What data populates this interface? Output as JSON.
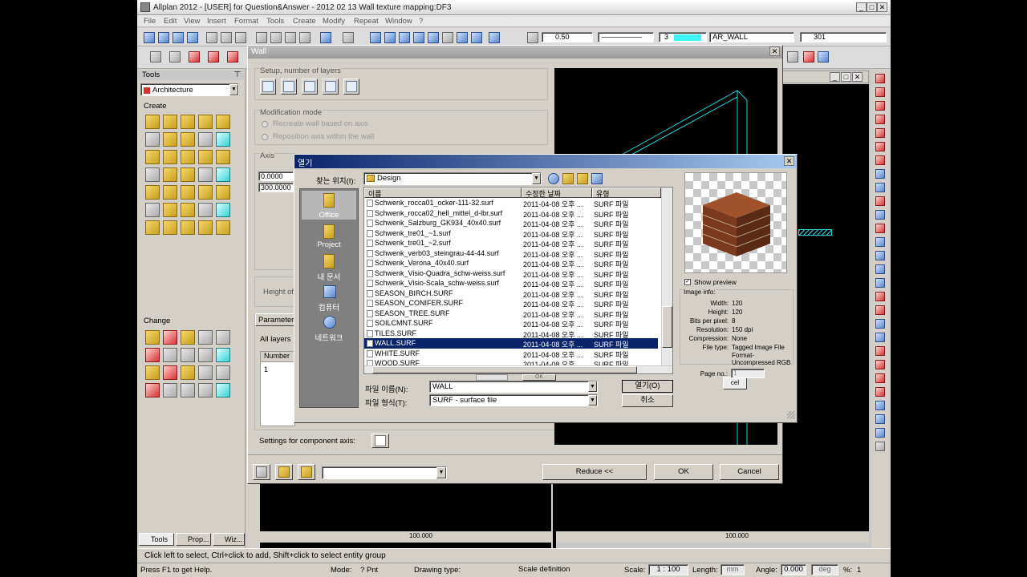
{
  "app": {
    "title": "Allplan 2012 - [USER] for Question&Answer - 2012 02 13 Wall texture mapping:DF3",
    "menu": [
      "File",
      "Edit",
      "View",
      "Insert",
      "Format",
      "Tools",
      "Create",
      "Modify",
      "Repeat",
      "Window",
      "?"
    ],
    "pen_value": "0.50",
    "color_value": "3",
    "layer_value": "AR_WALL",
    "pattern_value": "301"
  },
  "tools_panel": {
    "title": "Tools",
    "module": "Architecture",
    "create_label": "Create",
    "change_label": "Change",
    "tabs": [
      "Tools",
      "Prop...",
      "Wiz..."
    ]
  },
  "wall_dialog": {
    "title": "Wall",
    "setup_label": "Setup, number of layers",
    "mod_mode_label": "Modification mode",
    "recreate_label": "Recreate wall based on axis",
    "reposition_label": "Reposition axis within the wall",
    "axis_label": "Axis",
    "axis_val1": "0.0000",
    "axis_val2": "300.0000",
    "height_label": "Height of",
    "param_label": "Parameter",
    "all_layers_label": "All layers",
    "number_col": "Number",
    "number_val": "1",
    "settings_label": "Settings for component axis:",
    "reduce_button": "Reduce <<",
    "ok_button": "OK",
    "cancel_button": "Cancel"
  },
  "open_dialog": {
    "title": "열기",
    "lookin_label": "찾는 위치(I):",
    "lookin_value": "Design",
    "places": [
      "Office",
      "Project",
      "내 문서",
      "컴퓨터",
      "네트워크"
    ],
    "columns": [
      "이름",
      "수정한 날짜",
      "유형"
    ],
    "files": [
      {
        "name": "Schwenk_rocca01_ocker-111-32.surf",
        "date": "2011-04-08 오후 ...",
        "type": "SURF 파일"
      },
      {
        "name": "Schwenk_rocca02_hell_mittel_d-lbr.surf",
        "date": "2011-04-08 오후 ...",
        "type": "SURF 파일"
      },
      {
        "name": "Schwenk_Salzburg_GK934_40x40.surf",
        "date": "2011-04-08 오후 ...",
        "type": "SURF 파일"
      },
      {
        "name": "Schwenk_tre01_~1.surf",
        "date": "2011-04-08 오후 ...",
        "type": "SURF 파일"
      },
      {
        "name": "Schwenk_tre01_~2.surf",
        "date": "2011-04-08 오후 ...",
        "type": "SURF 파일"
      },
      {
        "name": "Schwenk_verb03_steingrau-44-44.surf",
        "date": "2011-04-08 오후 ...",
        "type": "SURF 파일"
      },
      {
        "name": "Schwenk_Verona_40x40.surf",
        "date": "2011-04-08 오후 ...",
        "type": "SURF 파일"
      },
      {
        "name": "Schwenk_Visio-Quadra_schw-weiss.surf",
        "date": "2011-04-08 오후 ...",
        "type": "SURF 파일"
      },
      {
        "name": "Schwenk_Visio-Scala_schw-weiss.surf",
        "date": "2011-04-08 오후 ...",
        "type": "SURF 파일"
      },
      {
        "name": "SEASON_BIRCH.SURF",
        "date": "2011-04-08 오후 ...",
        "type": "SURF 파일"
      },
      {
        "name": "SEASON_CONIFER.SURF",
        "date": "2011-04-08 오후 ...",
        "type": "SURF 파일"
      },
      {
        "name": "SEASON_TREE.SURF",
        "date": "2011-04-08 오후 ...",
        "type": "SURF 파일"
      },
      {
        "name": "SOILCMNT.SURF",
        "date": "2011-04-08 오후 ...",
        "type": "SURF 파일"
      },
      {
        "name": "TILES.SURF",
        "date": "2011-04-08 오후 ...",
        "type": "SURF 파일"
      },
      {
        "name": "WALL.SURF",
        "date": "2011-04-08 오후 ...",
        "type": "SURF 파일",
        "selected": true
      },
      {
        "name": "WHITE.SURF",
        "date": "2011-04-08 오후 ...",
        "type": "SURF 파일"
      },
      {
        "name": "WOOD.SURF",
        "date": "2011-04-08 오후 ...",
        "type": "SURF 파일"
      }
    ],
    "filename_label": "파일 이름(N):",
    "filename_value": "WALL",
    "filetype_label": "파일 형식(T):",
    "filetype_value": "SURF - surface file",
    "open_button": "열기(O)",
    "cancel_button": "취소",
    "show_preview_label": "Show preview",
    "image_info": {
      "title": "Image info:",
      "width_label": "Width:",
      "width": "120",
      "height_label": "Height:",
      "height": "120",
      "bpp_label": "Bits per pixel:",
      "bpp": "8",
      "res_label": "Resolution:",
      "res": "150 dpi",
      "comp_label": "Compression:",
      "comp": "None",
      "ftype_label": "File type:",
      "ftype": "Tagged Image File Format-Uncompressed RGB",
      "page_label": "Page no.:",
      "page": "1"
    },
    "hidden_ok": "OK",
    "hidden_cancel": "cel"
  },
  "viewport": {
    "zoom_left": "100.000",
    "zoom_right": "100.000"
  },
  "prompt": "Click left to select, Ctrl+click to add, Shift+click to select entity group",
  "status": {
    "help": "Press F1 to get Help.",
    "mode_label": "Mode:",
    "mode_value": "? Pnt",
    "drawing_type_label": "Drawing type:",
    "scale_def": "Scale definition",
    "scale_label": "Scale:",
    "scale_value": "1 : 100",
    "length_label": "Length:",
    "length_value": "mm",
    "angle_label": "Angle:",
    "angle_value": "0.000",
    "deg": "deg",
    "pct_label": "%:",
    "pct_value": "1"
  }
}
